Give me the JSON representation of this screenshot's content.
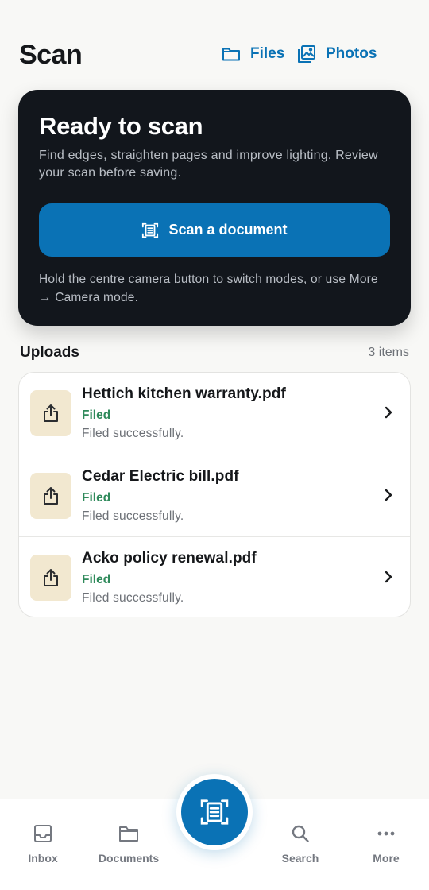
{
  "header": {
    "title": "Scan",
    "files_label": "Files",
    "photos_label": "Photos",
    "files_icon": "folder-icon",
    "photos_icon": "photos-icon"
  },
  "scan_card": {
    "title": "Ready to scan",
    "description": "Find edges, straighten pages and improve lighting. Review your scan before saving.",
    "button_label": "Scan a document",
    "button_icon": "document-scan-icon",
    "hint": "Hold the centre camera button to switch modes, or use More → Camera mode."
  },
  "uploads": {
    "title": "Uploads",
    "count": "3 items",
    "items": [
      {
        "name": "Hettich kitchen warranty.pdf",
        "status": "Filed",
        "detail": "Filed successfully.",
        "icon": "upload-share-icon"
      },
      {
        "name": "Cedar Electric bill.pdf",
        "status": "Filed",
        "detail": "Filed successfully.",
        "icon": "upload-share-icon"
      },
      {
        "name": "Acko policy renewal.pdf",
        "status": "Filed",
        "detail": "Filed successfully.",
        "icon": "upload-share-icon"
      }
    ]
  },
  "bottom_nav": {
    "items": [
      {
        "label": "Inbox",
        "icon": "inbox-icon"
      },
      {
        "label": "Documents",
        "icon": "folder-icon"
      },
      {
        "label": "Search",
        "icon": "search-icon"
      },
      {
        "label": "More",
        "icon": "more-icon"
      }
    ],
    "center_icon": "document-scan-icon"
  },
  "colors": {
    "accent": "#0a72b5",
    "card_bg": "#12161c",
    "status_green": "#2f8a5b",
    "thumb_bg": "#f2e8d0",
    "page_bg": "#f8f8f6"
  }
}
